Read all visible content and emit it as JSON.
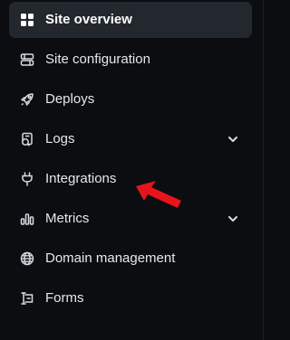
{
  "sidebar": {
    "items": [
      {
        "label": "Site overview",
        "icon": "grid-icon",
        "active": true
      },
      {
        "label": "Site configuration",
        "icon": "sliders-icon"
      },
      {
        "label": "Deploys",
        "icon": "rocket-icon"
      },
      {
        "label": "Logs",
        "icon": "logs-icon",
        "expandable": true
      },
      {
        "label": "Integrations",
        "icon": "plug-icon"
      },
      {
        "label": "Metrics",
        "icon": "bar-chart-icon",
        "expandable": true
      },
      {
        "label": "Domain management",
        "icon": "globe-icon"
      },
      {
        "label": "Forms",
        "icon": "forms-icon"
      }
    ]
  },
  "colors": {
    "background": "#0b0d10",
    "active_background": "#23272e",
    "text": "#e6e8eb",
    "annotation_arrow": "#e8141c"
  }
}
